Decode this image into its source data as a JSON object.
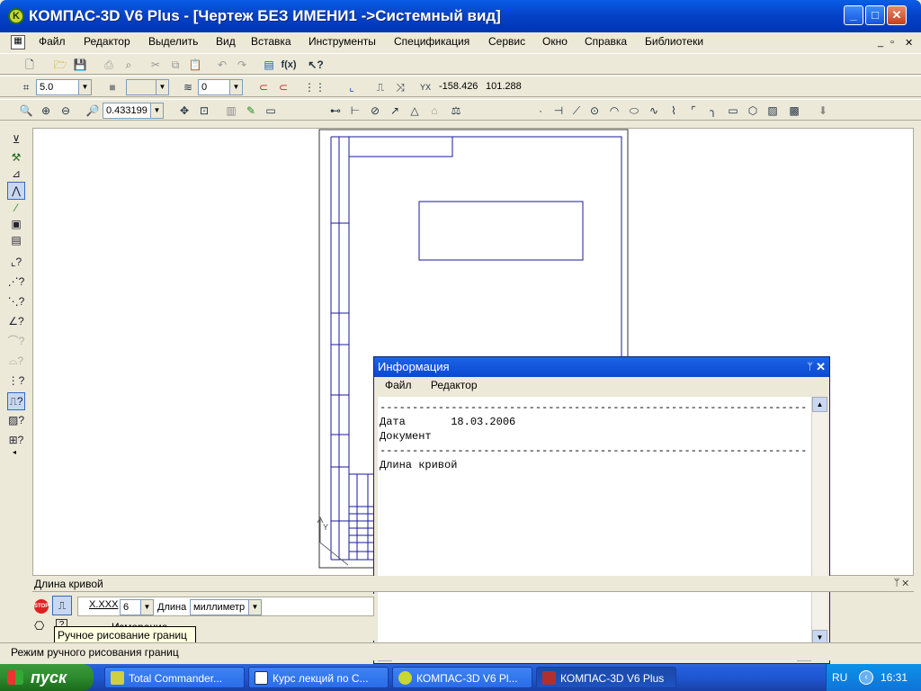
{
  "window": {
    "title": "КОМПАС-3D V6 Plus - [Чертеж БЕЗ ИМЕНИ1 ->Системный вид]"
  },
  "menu": {
    "items": [
      "Файл",
      "Редактор",
      "Выделить",
      "Вид",
      "Вставка",
      "Инструменты",
      "Спецификация",
      "Сервис",
      "Окно",
      "Справка",
      "Библиотеки"
    ]
  },
  "toolbar2": {
    "step_value": "5.0",
    "layer_value": "0",
    "coord_x": "-158.426",
    "coord_y": "101.288"
  },
  "toolbar3": {
    "zoom_value": "0.433199"
  },
  "info_panel": {
    "title": "Информация",
    "menu": [
      "Файл",
      "Редактор"
    ],
    "lines": [
      "------------------------------------------------------------------",
      "Дата       18.03.2006",
      "Документ",
      "------------------------------------------------------------------",
      "Длина кривой"
    ]
  },
  "property_bar": {
    "title": "Длина кривой",
    "precision_label": "X.XXX",
    "precision_value": "6",
    "length_label": "Длина",
    "units_value": "миллиметр",
    "tab_label": "Измерение"
  },
  "tooltip": "Ручное рисование границ",
  "status_text": "Режим ручного рисования границ",
  "taskbar": {
    "start_label": "пуск",
    "tasks": [
      "Total Commander...",
      "Курс лекций по С...",
      "КОМПАС-3D V6 Pl...",
      "КОМПАС-3D V6 Plus"
    ],
    "language": "RU",
    "clock": "16:31"
  },
  "colors": {
    "accent": "#0a48d0",
    "drawing_line": "#1a1a9a",
    "taskbar": "#245edb",
    "start": "#2d8a2d"
  }
}
